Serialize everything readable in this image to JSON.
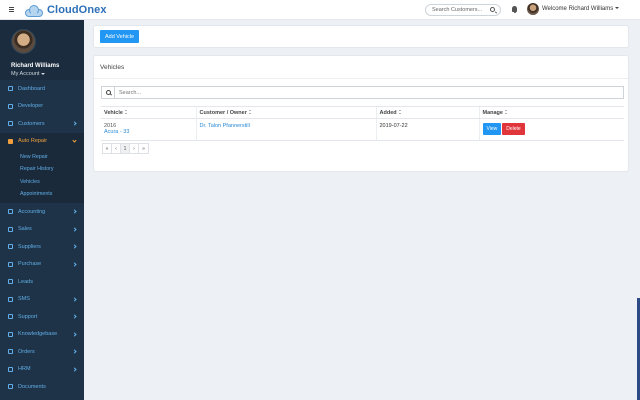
{
  "app": {
    "logo_part1": "Cloud",
    "logo_part2": "Onex"
  },
  "header": {
    "search_placeholder": "Search Customers...",
    "welcome": "Welcome Richard Williams"
  },
  "profile": {
    "name": "Richard Williams",
    "sub": "My Account"
  },
  "sidebar": {
    "items": [
      {
        "label": "Dashboard",
        "icon": "dashboard-icon",
        "chevron": false
      },
      {
        "label": "Developer",
        "icon": "code-icon",
        "chevron": false
      },
      {
        "label": "Customers",
        "icon": "users-icon",
        "chevron": true
      },
      {
        "label": "Auto Repair",
        "icon": "car-icon",
        "chevron": true,
        "active": true
      },
      {
        "label": "Accounting",
        "icon": "bank-icon",
        "chevron": true
      },
      {
        "label": "Sales",
        "icon": "cart-icon",
        "chevron": true
      },
      {
        "label": "Suppliers",
        "icon": "truck-icon",
        "chevron": true
      },
      {
        "label": "Purchase",
        "icon": "bag-icon",
        "chevron": true
      },
      {
        "label": "Leads",
        "icon": "user-plus-icon",
        "chevron": false
      },
      {
        "label": "SMS",
        "icon": "mail-icon",
        "chevron": true
      },
      {
        "label": "Support",
        "icon": "lifebuoy-icon",
        "chevron": true
      },
      {
        "label": "Knowledgebase",
        "icon": "book-icon",
        "chevron": true
      },
      {
        "label": "Orders",
        "icon": "list-icon",
        "chevron": true
      },
      {
        "label": "HRM",
        "icon": "people-icon",
        "chevron": true
      },
      {
        "label": "Documents",
        "icon": "file-icon",
        "chevron": false
      }
    ],
    "submenu": [
      "New Repair",
      "Repair History",
      "Vehicles",
      "Appointments"
    ]
  },
  "actions": {
    "add_vehicle": "Add Vehicle"
  },
  "vehicles": {
    "title": "Vehicles",
    "search_placeholder": "Search...",
    "columns": [
      "Vehicle",
      "Customer / Owner",
      "Added",
      "Manage"
    ],
    "rows": [
      {
        "year": "2016",
        "model": "Acura - 33",
        "owner": "Dr. Talon Pfannerstill",
        "added": "2019-07-22",
        "view": "View",
        "delete": "Delete"
      }
    ],
    "pager": [
      "«",
      "‹",
      "1",
      "›",
      "»"
    ]
  },
  "colors": {
    "sidebar": "#1e3347",
    "accent": "#2196f3",
    "danger": "#e0353b",
    "active": "#f0a03c"
  }
}
